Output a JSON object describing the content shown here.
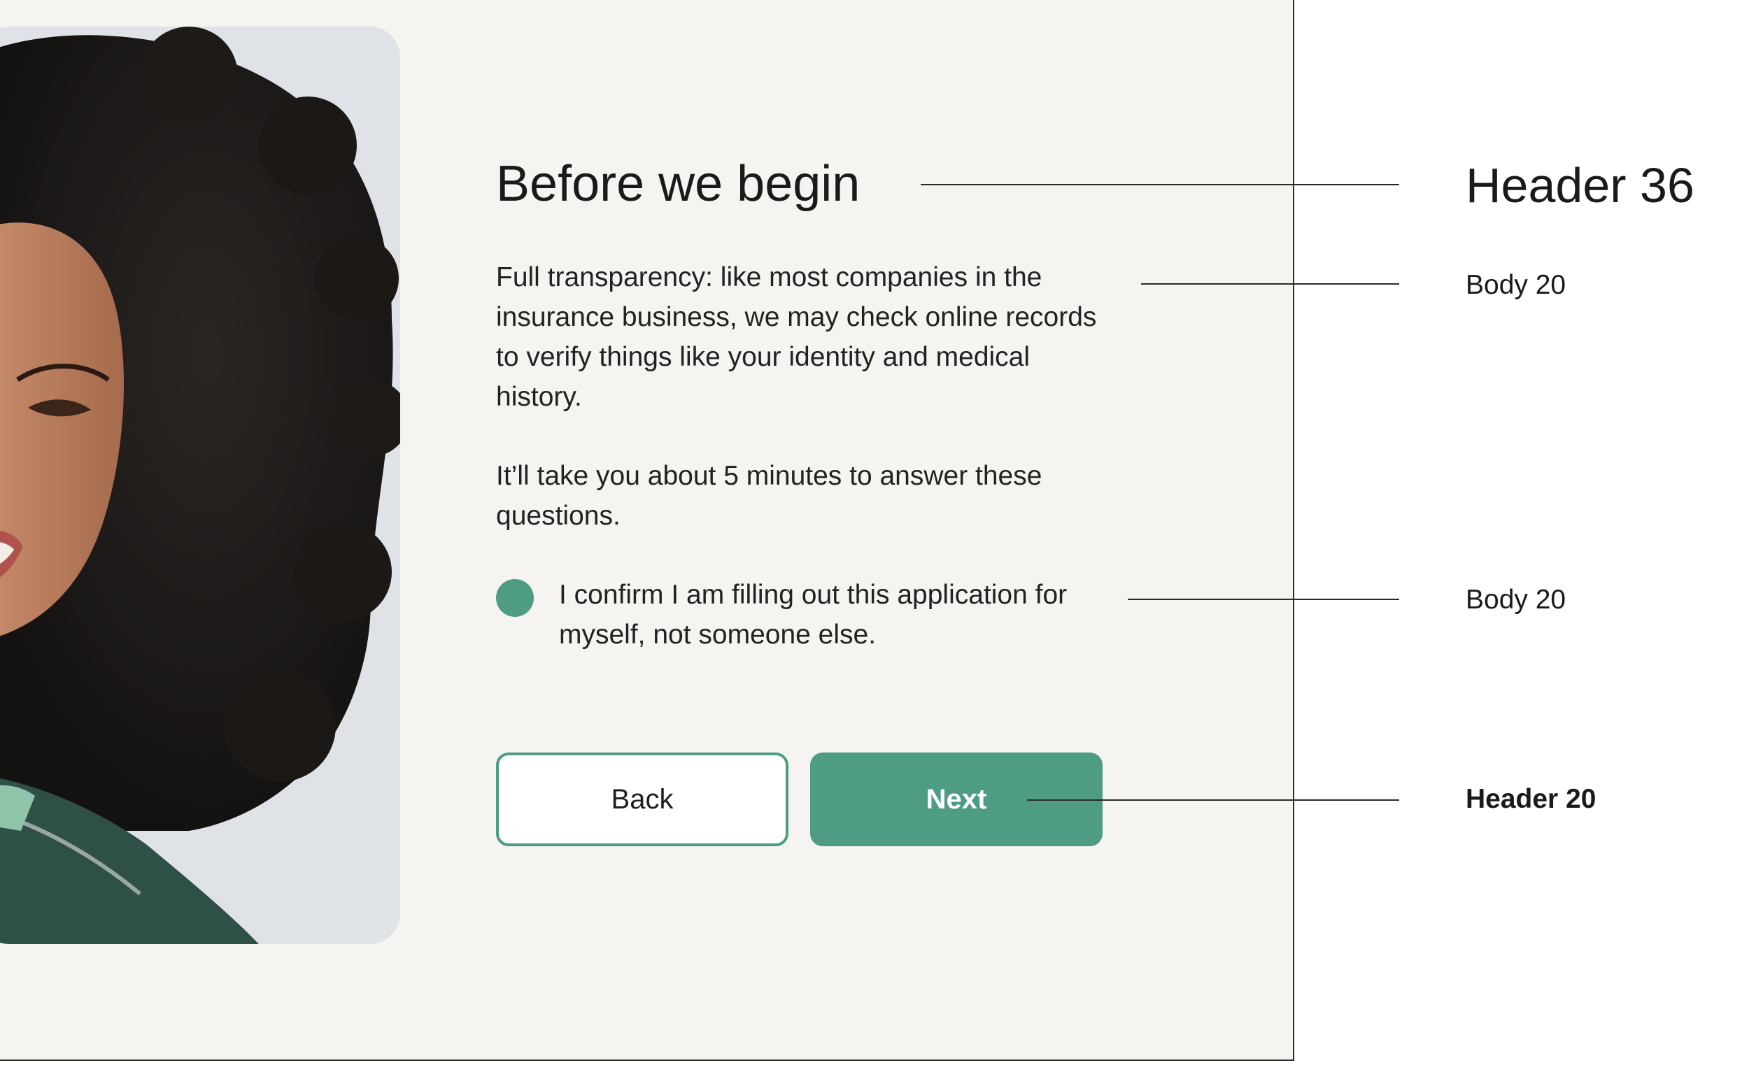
{
  "screen": {
    "title": "Before we begin",
    "paragraphs": [
      "Full transparency: like most companies in the insurance business, we may check online records to verify things like your identity and medical history.",
      "It’ll take you about 5 minutes to answer these questions."
    ],
    "confirm": {
      "label": "I confirm I am filling out this application for myself, not someone else.",
      "selected": true
    },
    "buttons": {
      "back_label": "Back",
      "next_label": "Next"
    }
  },
  "annotations": {
    "title_style": "Header 36",
    "body_style_1": "Body 20",
    "body_style_2": "Body 20",
    "button_style": "Header 20"
  },
  "colors": {
    "accent": "#4e9c84",
    "background": "#f6f4f0",
    "text": "#1c1c1c"
  },
  "images": {
    "portrait": "smiling-woman-curly-hair-photo"
  }
}
